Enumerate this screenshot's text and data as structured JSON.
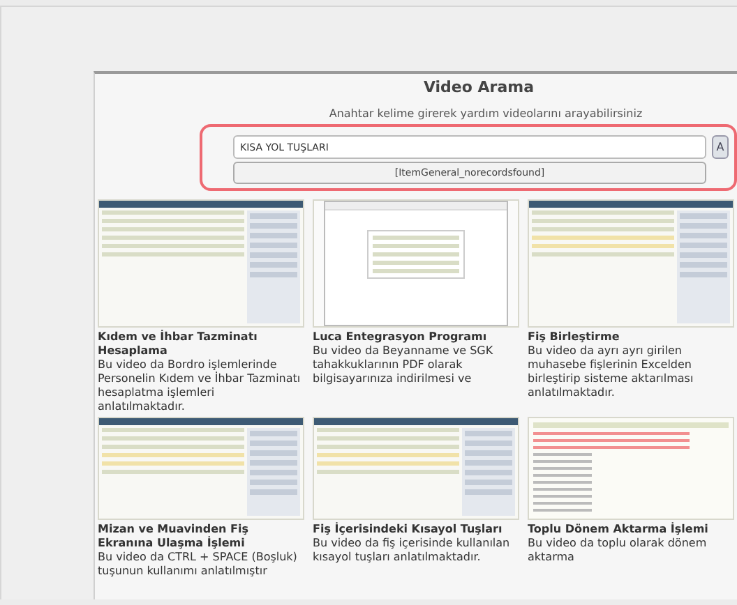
{
  "title": "Video Arama",
  "subtitle": "Anahtar kelime girerek yardım videolarını arayabilirsiniz",
  "search": {
    "value": "KISA YOL TUŞLARI",
    "button": "A",
    "message": "[ItemGeneral_norecordsfound]"
  },
  "videos": [
    {
      "title": "Kıdem ve İhbar Tazminatı Hesaplama",
      "description": "Bu video da Bordro işlemlerinde Personelin Kıdem ve İhbar Tazminatı hesaplatma işlemleri anlatılmaktadır.",
      "kind": "form"
    },
    {
      "title": "Luca Entegrasyon Programı",
      "description": "Bu video da Beyanname ve SGK tahakkuklarının PDF olarak bilgisayarınıza indirilmesi ve",
      "kind": "dialog"
    },
    {
      "title": "Fiş Birleştirme",
      "description": "Bu video da ayrı ayrı girilen muhasebe fişlerinin Excelden birleştirip sisteme aktarılması anlatılmaktadır.",
      "kind": "table"
    },
    {
      "title": "Mizan ve Muavinden Fiş Ekranına Ulaşma İşlemi",
      "description": "Bu video da CTRL + SPACE (Boşluk) tuşunun kullanımı anlatılmıştır",
      "kind": "table"
    },
    {
      "title": "Fiş İçerisindeki Kısayol Tuşları",
      "description": "Bu video da fiş içerisinde kullanılan kısayol tuşları anlatılmaktadır.",
      "kind": "table"
    },
    {
      "title": "Toplu Dönem Aktarma İşlemi",
      "description": "Bu video da toplu olarak dönem aktarma",
      "kind": "list"
    }
  ]
}
